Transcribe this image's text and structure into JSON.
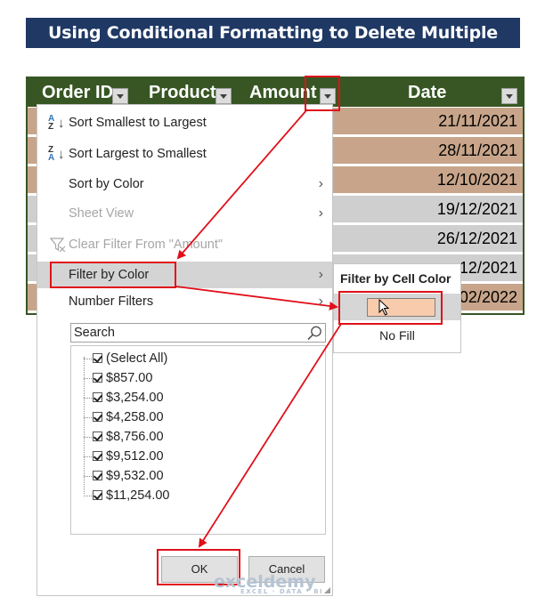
{
  "banner": {
    "title": "Using Conditional Formatting to Delete Multiple Rows"
  },
  "sheet": {
    "headers": [
      "Order ID",
      "Product",
      "Amount",
      "Date"
    ],
    "dates": [
      "21/11/2021",
      "28/11/2021",
      "12/10/2021",
      "19/12/2021",
      "26/12/2021",
      "12/2021",
      "02/2022"
    ],
    "row_colors": [
      "#c8a58a",
      "#c8a58a",
      "#c8a58a",
      "#cfcfcf",
      "#cfcfcf",
      "#cfcfcf",
      "#c8a58a"
    ]
  },
  "menu": {
    "sort_asc": "Sort Smallest to Largest",
    "sort_desc": "Sort Largest to Smallest",
    "sort_by_color": "Sort by Color",
    "sheet_view": "Sheet View",
    "clear_filter": "Clear Filter From \"Amount\"",
    "filter_by_color": "Filter by Color",
    "number_filters": "Number Filters",
    "search_placeholder": "Search",
    "items": [
      "(Select All)",
      "$857.00",
      "$3,254.00",
      "$4,258.00",
      "$8,756.00",
      "$9,512.00",
      "$9,532.00",
      "$11,254.00"
    ],
    "ok": "OK",
    "cancel": "Cancel"
  },
  "submenu": {
    "title": "Filter by Cell Color",
    "swatch_color": "#f8cbad",
    "no_fill": "No Fill"
  },
  "watermark": {
    "brand": "exceldemy",
    "tagline": "EXCEL · DATA · BI"
  }
}
